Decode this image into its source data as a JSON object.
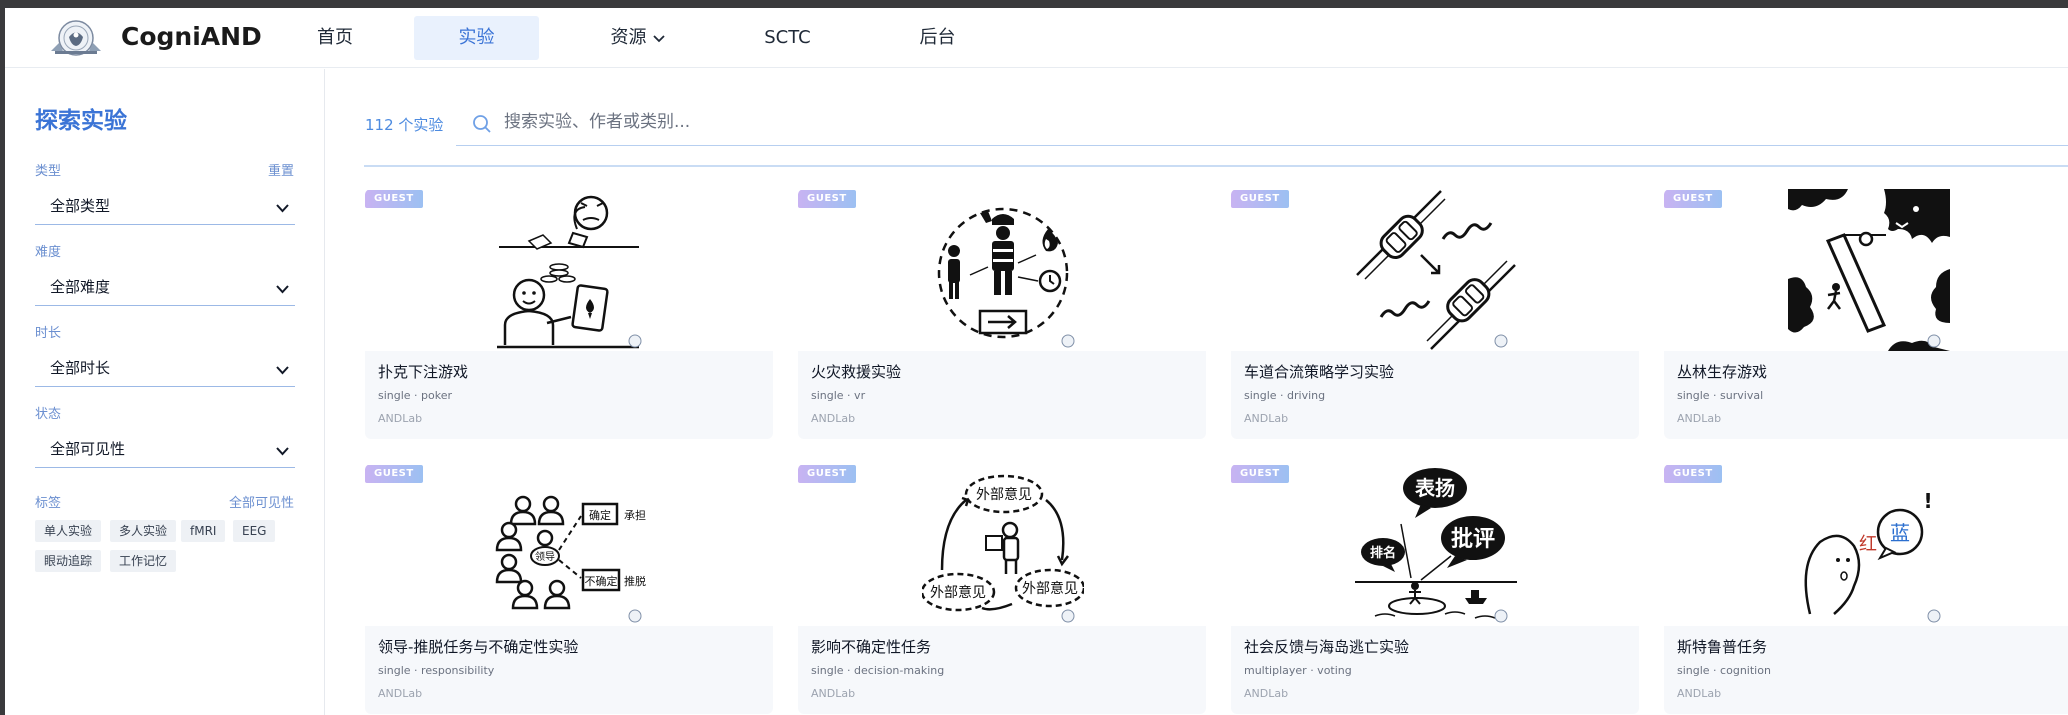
{
  "brand": {
    "name": "CogniAND"
  },
  "nav": {
    "home": "首页",
    "experiments": "实验",
    "resources": "资源",
    "sctc": "SCTC",
    "backend": "后台"
  },
  "sidebar": {
    "title": "探索实验",
    "type_label": "类型",
    "reset": "重置",
    "type_value": "全部类型",
    "difficulty_label": "难度",
    "difficulty_value": "全部难度",
    "duration_label": "时长",
    "duration_value": "全部时长",
    "status_label": "状态",
    "status_value": "全部可见性",
    "tags_label": "标签",
    "tags_all": "全部可见性",
    "tags": [
      "单人实验",
      "多人实验",
      "fMRI",
      "EEG",
      "眼动追踪",
      "工作记忆"
    ]
  },
  "main": {
    "count": "112 个实验",
    "search_placeholder": "搜索实验、作者或类别..."
  },
  "cards": [
    {
      "badge": "GUEST",
      "title": "扑克下注游戏",
      "meta": "single · poker",
      "author": "ANDLab",
      "icon": "poker-illustration"
    },
    {
      "badge": "GUEST",
      "title": "火灾救援实验",
      "meta": "single · vr",
      "author": "ANDLab",
      "icon": "fire-rescue-illustration"
    },
    {
      "badge": "GUEST",
      "title": "车道合流策略学习实验",
      "meta": "single · driving",
      "author": "ANDLab",
      "icon": "lane-merge-illustration"
    },
    {
      "badge": "GUEST",
      "title": "丛林生存游戏",
      "meta": "single · survival",
      "author": "ANDLab",
      "icon": "jungle-survival-illustration"
    },
    {
      "badge": "GUEST",
      "title": "领导-推脱任务与不确定性实验",
      "meta": "single · responsibility",
      "author": "ANDLab",
      "icon": "leadership-illustration",
      "labels": [
        "确定",
        "承担",
        "不确定",
        "推脱",
        "领导"
      ]
    },
    {
      "badge": "GUEST",
      "title": "影响不确定性任务",
      "meta": "single · decision-making",
      "author": "ANDLab",
      "icon": "opinion-cycle-illustration",
      "labels": [
        "外部意见",
        "外部意见",
        "外部意见"
      ]
    },
    {
      "badge": "GUEST",
      "title": "社会反馈与海岛逃亡实验",
      "meta": "multiplayer · voting",
      "author": "ANDLab",
      "icon": "island-escape-illustration",
      "labels": [
        "表扬",
        "批评",
        "排名"
      ]
    },
    {
      "badge": "GUEST",
      "title": "斯特鲁普任务",
      "meta": "single · cognition",
      "author": "ANDLab",
      "icon": "stroop-illustration",
      "labels": [
        "红",
        "蓝",
        "!"
      ]
    }
  ],
  "colors": {
    "accent": "#3b74d6",
    "accent_light": "#e9f1fd",
    "badge_from": "#c8b3f2",
    "badge_to": "#9cc0f2"
  }
}
